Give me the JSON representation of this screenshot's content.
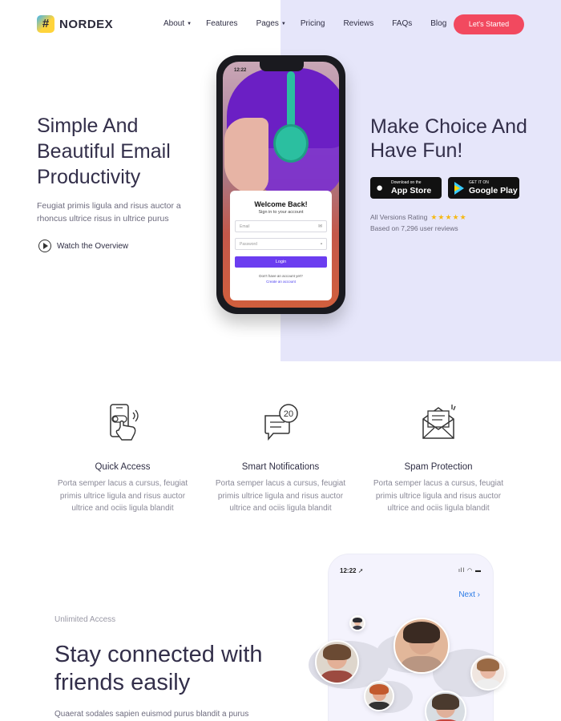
{
  "brand": {
    "name": "NORDEX",
    "mark": "#"
  },
  "nav": {
    "items": [
      {
        "label": "About",
        "has_caret": true
      },
      {
        "label": "Features",
        "has_caret": false
      },
      {
        "label": "Pages",
        "has_caret": true
      },
      {
        "label": "Pricing",
        "has_caret": false
      },
      {
        "label": "Reviews",
        "has_caret": false
      },
      {
        "label": "FAQs",
        "has_caret": false
      },
      {
        "label": "Blog",
        "has_caret": false
      }
    ],
    "cta_label": "Let's Started"
  },
  "hero": {
    "title": "Simple And Beautiful Email Productivity",
    "subtitle": "Feugiat primis ligula and risus auctor a rhoncus ultrice risus in ultrice purus",
    "watch_label": "Watch the Overview"
  },
  "phone_login": {
    "status_time": "12:22",
    "title": "Welcome Back!",
    "subtitle": "Sign in to your account",
    "email_placeholder": "Email",
    "password_placeholder": "Password",
    "login_label": "Login",
    "signup_question": "Don't have an account yet?",
    "signup_link": "Create an account"
  },
  "hero_right": {
    "title": "Make Choice And Have Fun!",
    "app_store": {
      "small": "Download on the",
      "big": "App Store"
    },
    "google_play": {
      "small": "GET IT ON",
      "big": "Google Play"
    },
    "rating_label": "All Versions Rating",
    "stars": "★★★★★",
    "reviews_text": "Based on 7,296 user reviews"
  },
  "features": [
    {
      "icon": "touch-phone-icon",
      "title": "Quick Access",
      "desc": "Porta semper lacus a cursus, feugiat primis ultrice ligula and risus auctor ultrice and ociis ligula blandit"
    },
    {
      "icon": "chat-notification-icon",
      "badge": "20",
      "title": "Smart Notifications",
      "desc": "Porta semper lacus a cursus, feugiat primis ultrice ligula and risus auctor ultrice and ociis ligula blandit"
    },
    {
      "icon": "envelope-icon",
      "title": "Spam Protection",
      "desc": "Porta semper lacus a cursus, feugiat primis ultrice ligula and risus auctor ultrice and ociis ligula blandit"
    }
  ],
  "connect": {
    "kicker": "Unlimited Access",
    "title": "Stay connected with friends easily",
    "subtitle": "Quaerat sodales sapien euismod purus blandit a purus"
  },
  "phone_friends": {
    "time": "12:22",
    "next_label": "Next"
  },
  "colors": {
    "accent": "#f2495f",
    "hero_bg": "#e6e6fa",
    "heading": "#332f4a",
    "login_button": "#6b3df0",
    "star": "#f5b917",
    "link_blue": "#2b7be6"
  }
}
